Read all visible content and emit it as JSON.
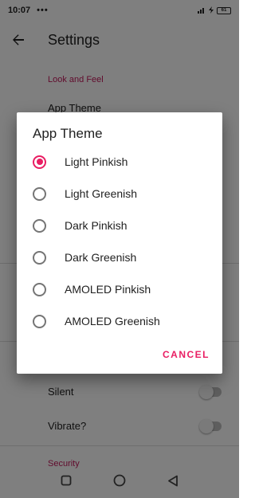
{
  "status_bar": {
    "time": "10:07",
    "dots": "•••",
    "battery": "61"
  },
  "app_bar": {
    "title": "Settings"
  },
  "settings": {
    "look_and_feel_header": "Look and Feel",
    "app_theme_label": "App Theme",
    "silent_label": "Silent",
    "vibrate_label": "Vibrate?",
    "security_header": "Security"
  },
  "dialog": {
    "title": "App Theme",
    "options": [
      {
        "label": "Light Pinkish",
        "selected": true
      },
      {
        "label": "Light Greenish",
        "selected": false
      },
      {
        "label": "Dark Pinkish",
        "selected": false
      },
      {
        "label": "Dark Greenish",
        "selected": false
      },
      {
        "label": "AMOLED Pinkish",
        "selected": false
      },
      {
        "label": "AMOLED Greenish",
        "selected": false
      }
    ],
    "cancel_label": "CANCEL"
  },
  "colors": {
    "accent": "#e91e63",
    "section_header": "#c2185b"
  }
}
